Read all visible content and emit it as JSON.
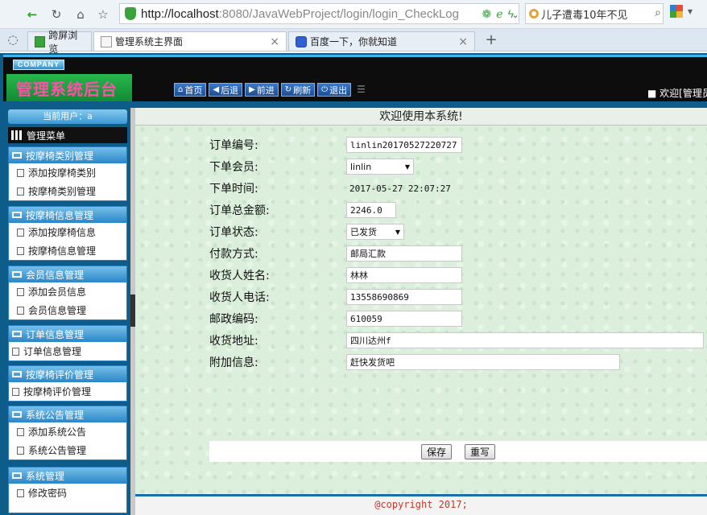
{
  "browser": {
    "url_host": "http://localhost",
    "url_rest": ":8080/JavaWebProject/login/login_CheckLog",
    "search_text": "儿子遭毒10年不见",
    "tabs": [
      {
        "label": "跨屏浏览"
      },
      {
        "label": "管理系统主界面"
      },
      {
        "label": "百度一下，你就知道"
      }
    ]
  },
  "header": {
    "company": "COMPANY",
    "title": "管理系统后台",
    "nav": [
      {
        "icon": "⌂",
        "label": "首页"
      },
      {
        "icon": "◀",
        "label": "后退"
      },
      {
        "icon": "▶",
        "label": "前进"
      },
      {
        "icon": "↻",
        "label": "刷新"
      },
      {
        "icon": "⏻",
        "label": "退出"
      }
    ],
    "welcome": "■ 欢迎[管理员"
  },
  "sidebar": {
    "current_user": "当前用户：a",
    "main_menu": "管理菜单",
    "groups": [
      {
        "title": "按摩椅类别管理",
        "items": [
          "添加按摩椅类别",
          "按摩椅类别管理"
        ]
      },
      {
        "title": "按摩椅信息管理",
        "items": [
          "添加按摩椅信息",
          "按摩椅信息管理"
        ]
      },
      {
        "title": "会员信息管理",
        "items": [
          "添加会员信息",
          "会员信息管理"
        ]
      },
      {
        "title": "订单信息管理",
        "items": [
          "订单信息管理"
        ]
      },
      {
        "title": "按摩椅评价管理",
        "items": [
          "按摩椅评价管理"
        ]
      },
      {
        "title": "系统公告管理",
        "items": [
          "添加系统公告",
          "系统公告管理"
        ]
      },
      {
        "title": "系统管理",
        "items": [
          "修改密码"
        ]
      }
    ]
  },
  "main": {
    "heading": "欢迎使用本系统!",
    "fields": {
      "order_no": {
        "label": "订单编号:",
        "value": "linlin20170527220727"
      },
      "member": {
        "label": "下单会员:",
        "value": "linlin"
      },
      "order_time": {
        "label": "下单时间:",
        "value": "2017-05-27 22:07:27"
      },
      "total": {
        "label": "订单总金额:",
        "value": "2246.0"
      },
      "status": {
        "label": "订单状态:",
        "value": "已发货"
      },
      "payment": {
        "label": "付款方式:",
        "value": "邮局汇款"
      },
      "receiver": {
        "label": "收货人姓名:",
        "value": "林林"
      },
      "phone": {
        "label": "收货人电话:",
        "value": "13558690869"
      },
      "postcode": {
        "label": "邮政编码:",
        "value": "610059"
      },
      "address": {
        "label": "收货地址:",
        "value": "四川达州f"
      },
      "note": {
        "label": "附加信息:",
        "value": "赶快发货吧"
      }
    },
    "save_label": "保存",
    "reset_label": "重写"
  },
  "footer": {
    "copyright": "@copyright 2017;"
  }
}
